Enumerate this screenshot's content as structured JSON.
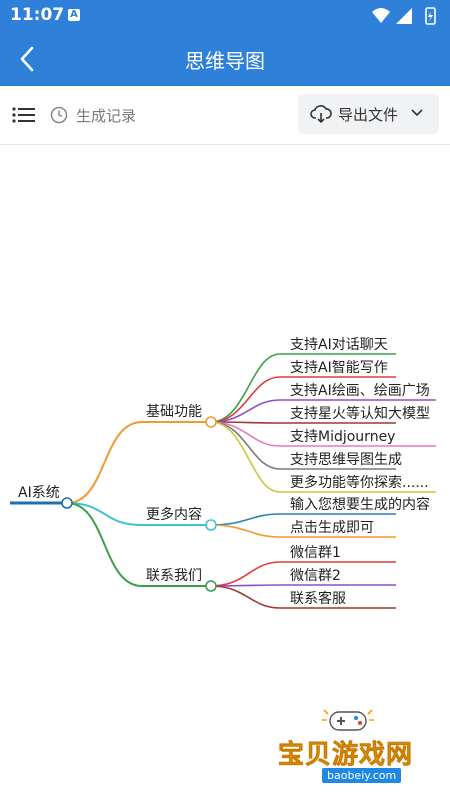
{
  "status": {
    "time": "11:07",
    "notification_icon": "A"
  },
  "nav": {
    "title": "思维导图"
  },
  "toolbar": {
    "history_label": "生成记录",
    "export_label": "导出文件"
  },
  "mindmap": {
    "root": "AI系统",
    "branches": [
      {
        "label": "基础功能",
        "color": "#f29a2e",
        "children": [
          {
            "label": "支持AI对话聊天",
            "color": "#3aa14a"
          },
          {
            "label": "支持AI智能写作",
            "color": "#e03b3b"
          },
          {
            "label": "支持AI绘画、绘画广场",
            "color": "#8e4fc7"
          },
          {
            "label": "支持星火等认知大模型",
            "color": "#a0392f"
          },
          {
            "label": "支持Midjourney",
            "color": "#e37bc0"
          },
          {
            "label": "支持思维导图生成",
            "color": "#7a7a7a"
          },
          {
            "label": "更多功能等你探索......",
            "color": "#c7c93a"
          }
        ]
      },
      {
        "label": "更多内容",
        "color": "#3cc4d3",
        "children": [
          {
            "label": "输入您想要生成的内容",
            "color": "#2f7fb6"
          },
          {
            "label": "点击生成即可",
            "color": "#f29a2e"
          }
        ]
      },
      {
        "label": "联系我们",
        "color": "#3aa14a",
        "children": [
          {
            "label": "微信群1",
            "color": "#e03b3b"
          },
          {
            "label": "微信群2",
            "color": "#8e4fc7"
          },
          {
            "label": "联系客服",
            "color": "#a0392f"
          }
        ]
      }
    ]
  },
  "watermark": {
    "text": "宝贝游戏网",
    "url": "baobeiy.com"
  }
}
